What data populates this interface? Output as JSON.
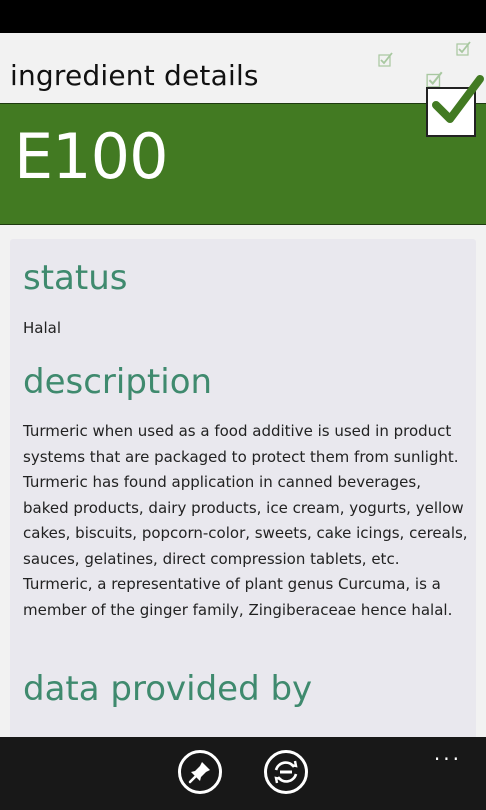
{
  "page": {
    "title": "ingredient details"
  },
  "ingredient": {
    "code": "E100"
  },
  "sections": {
    "status_heading": "status",
    "status_value": "Halal",
    "description_heading": "description",
    "description_text": "Turmeric when used as a food additive is used in product systems that are packaged to protect them from sunlight. Turmeric has found application in canned beverages, baked products, dairy products, ice cream, yogurts, yellow cakes, biscuits, popcorn-color, sweets, cake icings, cereals, sauces, gelatines, direct compression tablets, etc. Turmeric, a representative of plant genus Curcuma, is a member of the ginger family, Zingiberaceae hence halal.",
    "provider_heading": "data provided by"
  },
  "appbar": {
    "buttons": [
      "pin-icon",
      "sync-icon"
    ],
    "more_label": "..."
  },
  "colors": {
    "banner": "#427a22",
    "accent": "#3f8a6e",
    "check": "#427a22"
  }
}
